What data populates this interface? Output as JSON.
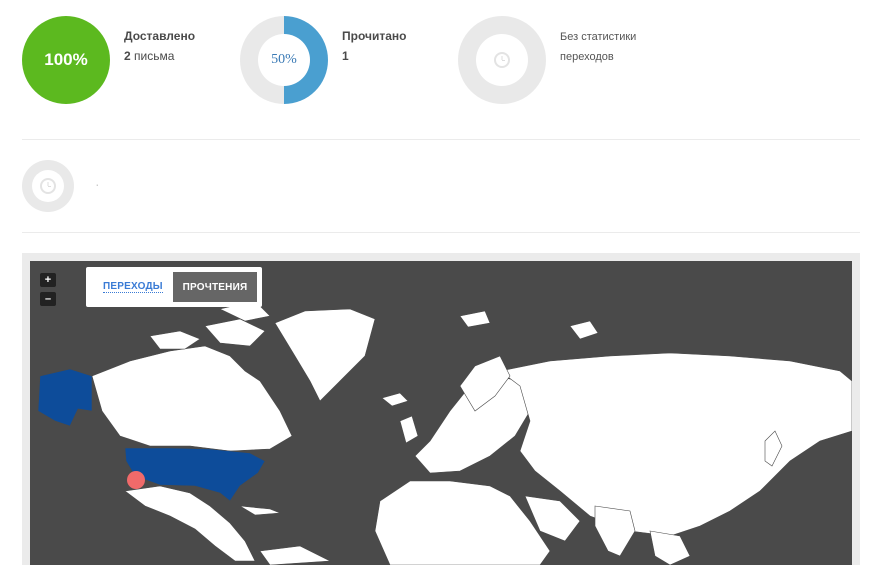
{
  "stats": {
    "delivered": {
      "percent_label": "100%",
      "title": "Доставлено",
      "count": "2",
      "count_unit": "письма",
      "value": 1.0,
      "color": "#5cb91f"
    },
    "read": {
      "percent_label": "50%",
      "title": "Прочитано",
      "count": "1",
      "value": 0.5,
      "color": "#4a9fd0"
    },
    "clicks": {
      "line1": "Без статистики",
      "line2": "переходов"
    }
  },
  "second_row": {
    "text": "·"
  },
  "map": {
    "zoom_in": "+",
    "zoom_out": "–",
    "tabs": [
      {
        "label": "ПЕРЕХОДЫ",
        "active": false
      },
      {
        "label": "ПРОЧТЕНИЯ",
        "active": true
      }
    ],
    "highlight_color": "#0d4c9a",
    "marker_color": "#f06a6a"
  }
}
